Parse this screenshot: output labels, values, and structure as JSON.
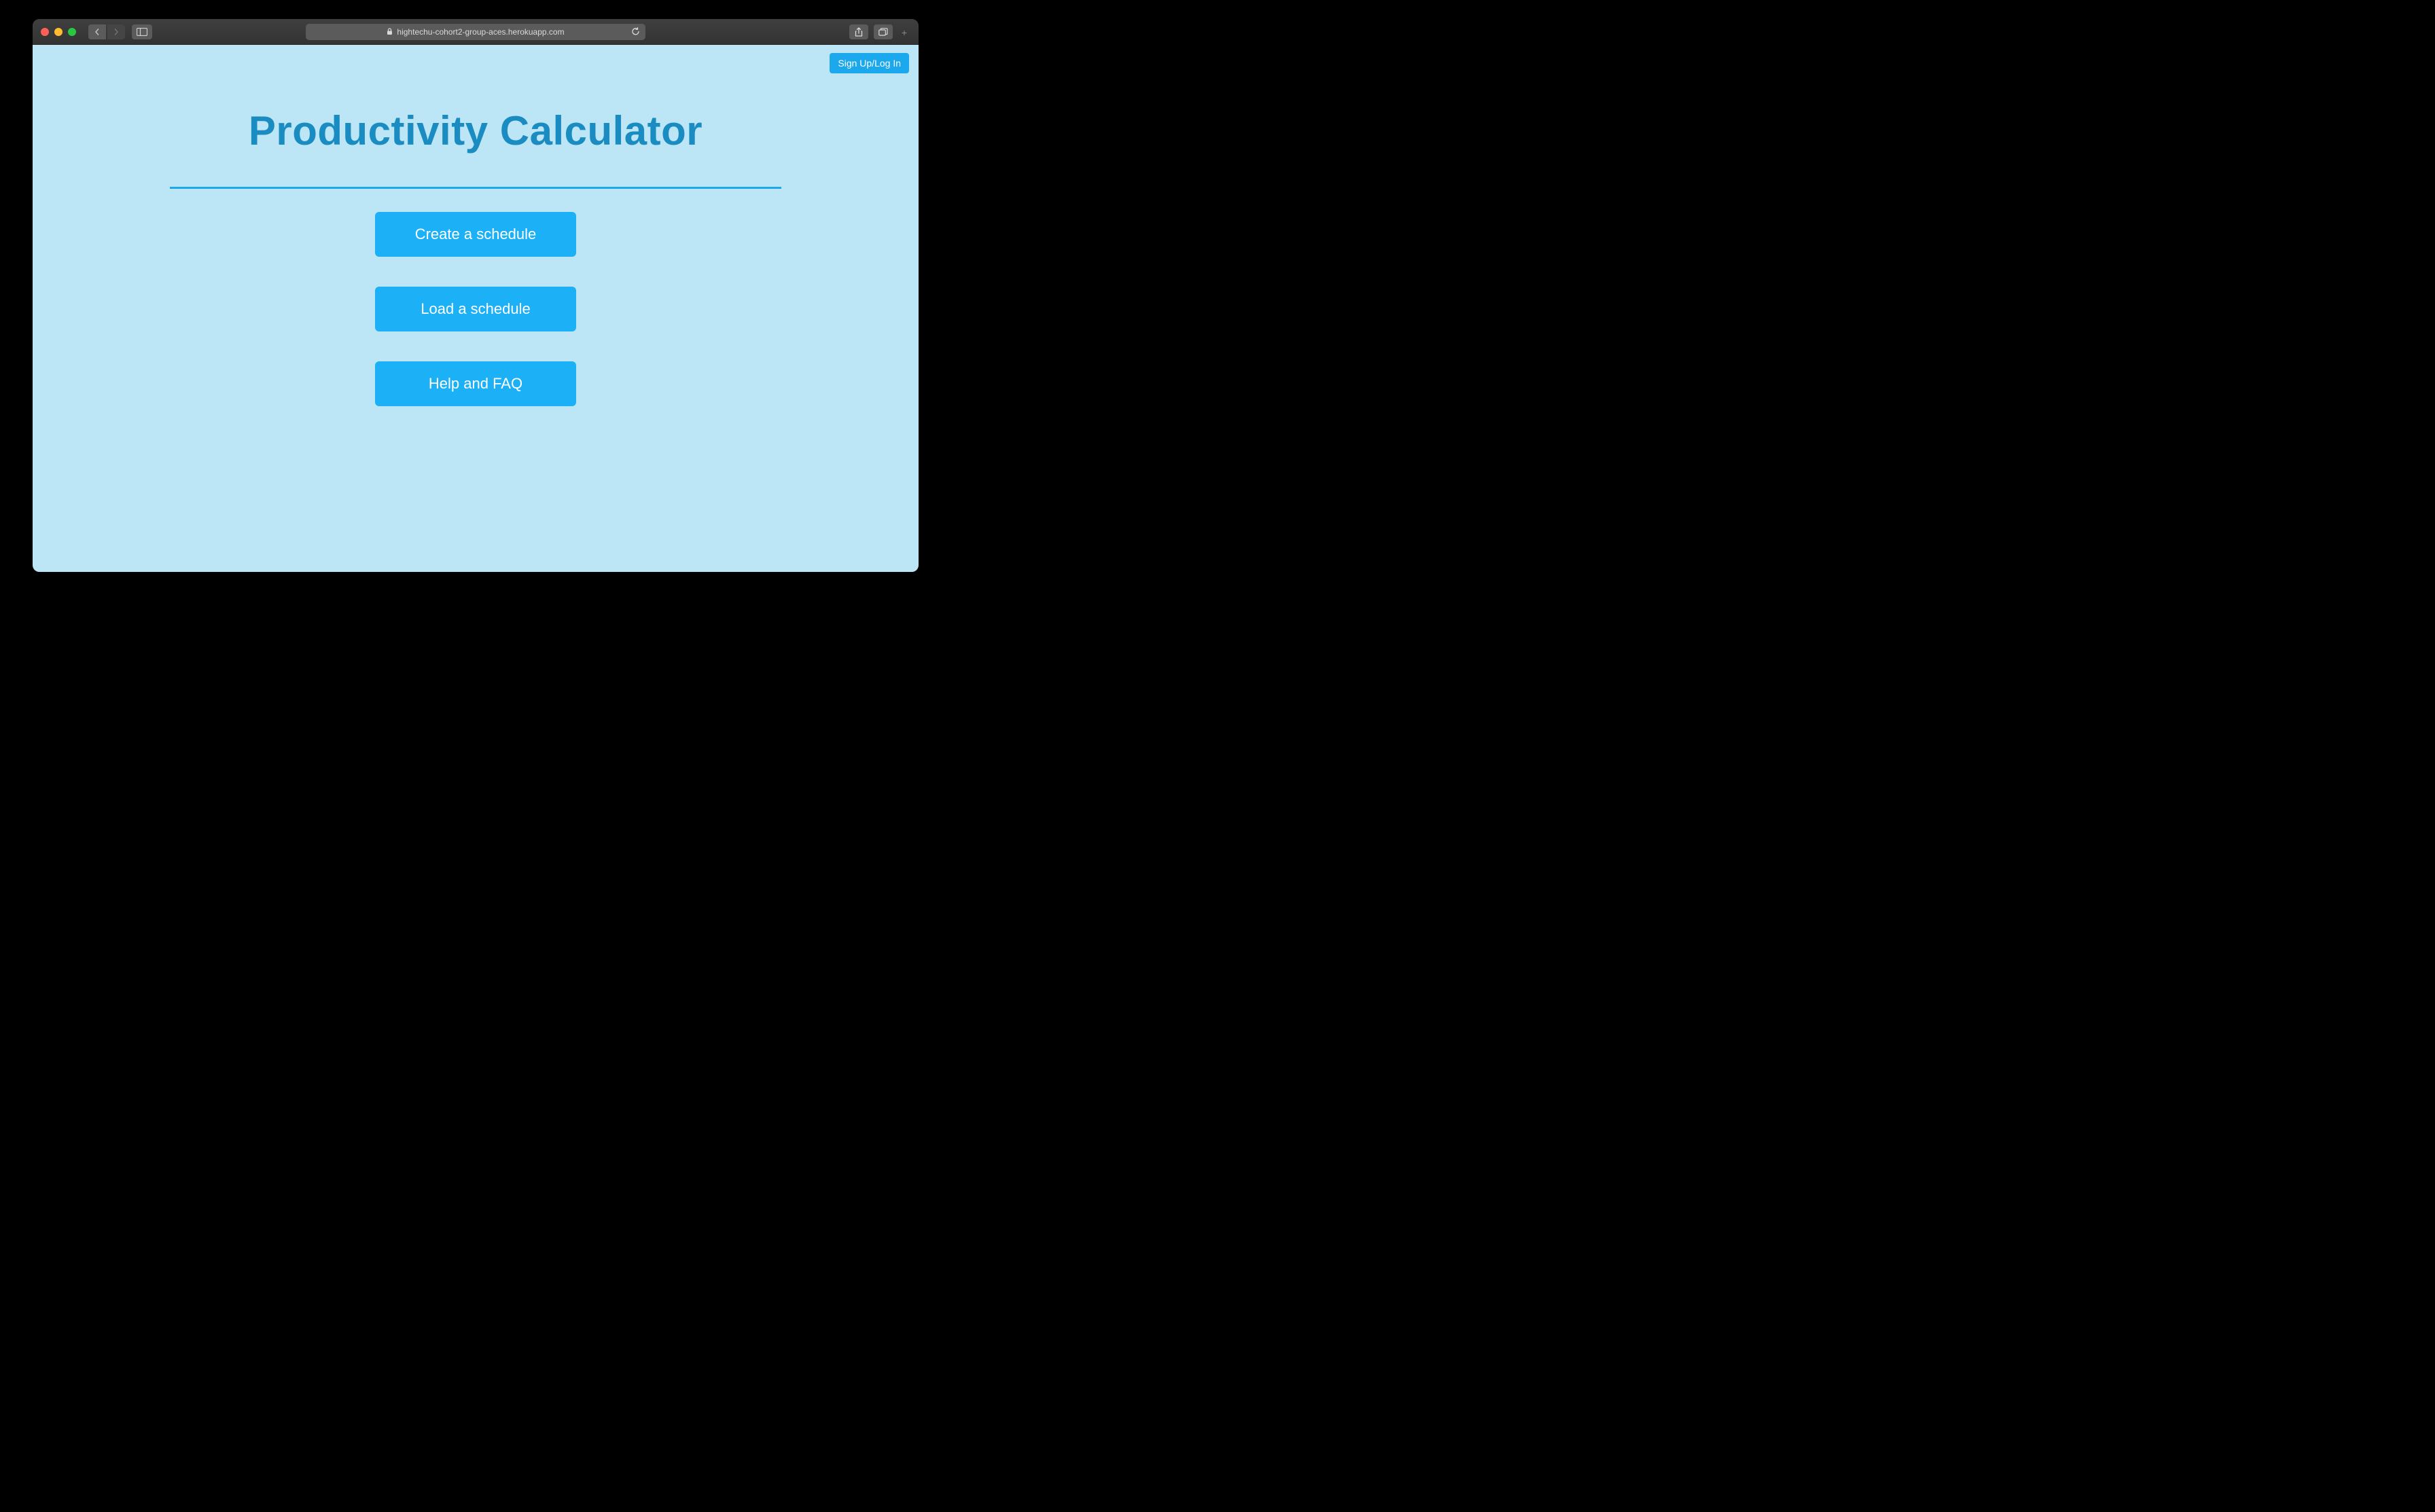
{
  "browser": {
    "url": "hightechu-cohort2-group-aces.herokuapp.com"
  },
  "header": {
    "signup_label": "Sign Up/Log In"
  },
  "page": {
    "title": "Productivity Calculator"
  },
  "actions": {
    "create_label": "Create a schedule",
    "load_label": "Load a schedule",
    "help_label": "Help and FAQ"
  }
}
